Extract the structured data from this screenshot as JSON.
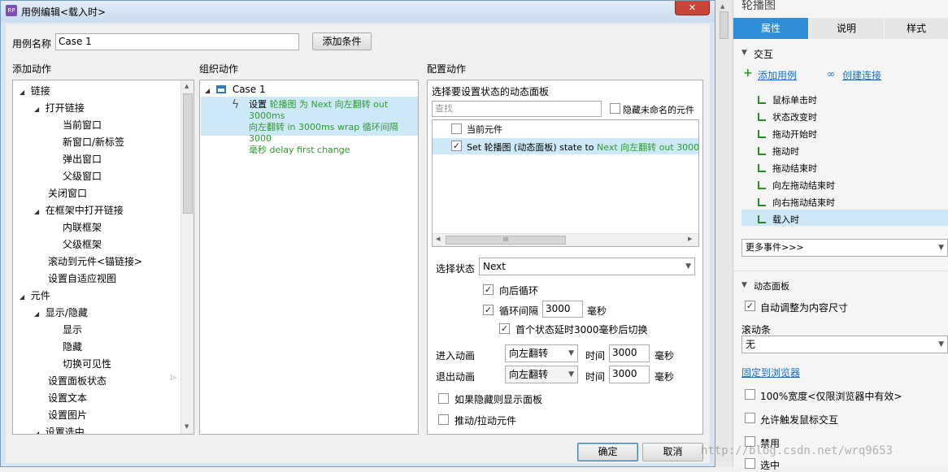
{
  "dialog": {
    "title": "用例编辑<载入时>",
    "close_label": "✕",
    "case_name_label": "用例名称",
    "case_name_value": "Case 1",
    "add_condition_label": "添加条件",
    "col_add_action": "添加动作",
    "col_organize_action": "组织动作",
    "col_config_action": "配置动作",
    "ok_label": "确定",
    "cancel_label": "取消"
  },
  "actions_tree": [
    {
      "label": "链接"
    },
    {
      "label": "打开链接"
    },
    {
      "label": "当前窗口"
    },
    {
      "label": "新窗口/新标签"
    },
    {
      "label": "弹出窗口"
    },
    {
      "label": "父级窗口"
    },
    {
      "label": "关闭窗口"
    },
    {
      "label": "在框架中打开链接"
    },
    {
      "label": "内联框架"
    },
    {
      "label": "父级框架"
    },
    {
      "label": "滚动到元件<锚链接>"
    },
    {
      "label": "设置自适应视图"
    },
    {
      "label": "元件"
    },
    {
      "label": "显示/隐藏"
    },
    {
      "label": "显示"
    },
    {
      "label": "隐藏"
    },
    {
      "label": "切换可见性"
    },
    {
      "label": "设置面板状态"
    },
    {
      "label": "设置文本"
    },
    {
      "label": "设置图片"
    },
    {
      "label": "设置选中"
    }
  ],
  "organize": {
    "case_label": "Case 1",
    "action_prefix": "设置",
    "action_green_1": "轮播图 为 Next 向左翻转 out 3000ms",
    "action_green_2": "向左翻转 in 3000ms wrap 循环间隔 3000",
    "action_green_3": "毫秒 delay first change"
  },
  "config": {
    "panel_title": "选择要设置状态的动态面板",
    "search_placeholder": "查找",
    "hide_unnamed_label": "隐藏未命名的元件",
    "current_element_label": "当前元件",
    "row_text_black": "Set 轮播图 (动态面板) state to",
    "row_text_green": "Next 向左翻转 out 3000ms 向",
    "select_state_label": "选择状态",
    "select_state_value": "Next",
    "wrap_label": "向后循环",
    "interval_label": "循环间隔",
    "interval_value": "3000",
    "ms_label": "毫秒",
    "first_delay_label": "首个状态延时3000毫秒后切换",
    "enter_anim_label": "进入动画",
    "enter_anim_value": "向左翻转",
    "time_label": "时间",
    "enter_time_value": "3000",
    "exit_anim_label": "退出动画",
    "exit_anim_value": "向左翻转",
    "exit_time_value": "3000",
    "show_if_hidden_label": "如果隐藏则显示面板",
    "push_pull_label": "推动/拉动元件",
    "hscroll_grip": "III"
  },
  "right_panel": {
    "title": "轮播图",
    "tabs": [
      "属性",
      "说明",
      "样式"
    ],
    "interaction_label": "交互",
    "add_case_label": "添加用例",
    "create_link_label": "创建连接",
    "events": [
      "鼠标单击时",
      "状态改变时",
      "拖动开始时",
      "拖动时",
      "拖动结束时",
      "向左拖动结束时",
      "向右拖动结束时",
      "载入时"
    ],
    "more_events_label": "更多事件>>>",
    "dynamic_panel_label": "动态面板",
    "auto_resize_label": "自动调整为内容尺寸",
    "scrollbar_label": "滚动条",
    "scrollbar_value": "无",
    "pin_browser_label": "固定到浏览器",
    "full_width_label": "100%宽度<仅限浏览器中有效>",
    "allow_mouse_label": "允许触发鼠标交互",
    "disable_label": "禁用",
    "selected_label": "选中",
    "watermark": "http://blog.csdn.net/wrq9653"
  },
  "colors": {
    "accent_blue": "#2f8fd8",
    "green_text": "#2a9d2a",
    "selection": "#cde8f7",
    "link": "#1a6fc9"
  }
}
